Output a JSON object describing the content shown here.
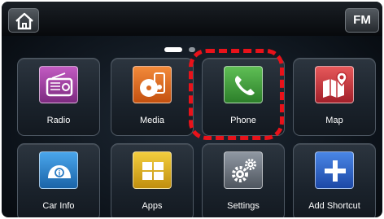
{
  "topbar": {
    "home_icon": "home-icon",
    "fm_label": "FM"
  },
  "pager": {
    "pages": 2,
    "current_page": 1
  },
  "tiles": [
    {
      "label": "Radio",
      "icon": "radio-icon",
      "color": "#a53fa5"
    },
    {
      "label": "Media",
      "icon": "media-icon",
      "color": "#e2681e"
    },
    {
      "label": "Phone",
      "icon": "phone-icon",
      "color": "#3e9a3a"
    },
    {
      "label": "Map",
      "icon": "map-icon",
      "color": "#d23a3e"
    },
    {
      "label": "Car Info",
      "icon": "car-info-icon",
      "color": "#2f86d0"
    },
    {
      "label": "Apps",
      "icon": "apps-icon",
      "color": "#e0b21e"
    },
    {
      "label": "Settings",
      "icon": "settings-icon",
      "color": "#707884"
    },
    {
      "label": "Add Shortcut",
      "icon": "add-shortcut-icon",
      "color": "#2b62c7"
    }
  ],
  "highlight_color": "#e8121a"
}
